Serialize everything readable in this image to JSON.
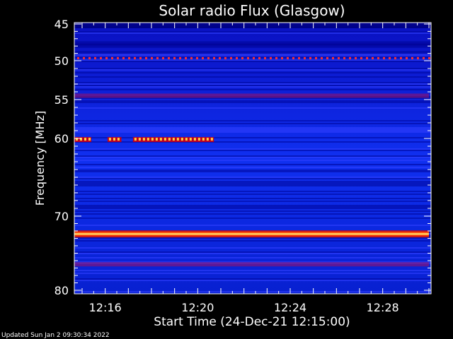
{
  "chart_data": {
    "type": "heatmap",
    "title": "Solar radio Flux (Glasgow)",
    "ylabel": "Frequency [MHz]",
    "xlabel": "Start Time (24-Dec-21 12:15:00)",
    "ylim": [
      80,
      45
    ],
    "yticks": [
      45,
      50,
      55,
      60,
      70,
      80
    ],
    "y_major_labels": [
      "45",
      "50",
      "55",
      "60",
      "70",
      "80"
    ],
    "x_range_minutes": [
      12.25,
      12.5
    ],
    "xticks": [
      "12:16",
      "12:20",
      "12:24",
      "12:28"
    ],
    "xtick_minutes_after_start": [
      1,
      5,
      9,
      13
    ],
    "x_span_minutes": [
      0,
      15
    ],
    "colormap": [
      "#0000a0",
      "#0020ff",
      "#a00040",
      "#ff2000",
      "#ffff60"
    ],
    "features": [
      {
        "label": "continuous band",
        "freq_mhz": 72.4,
        "start_min": 0,
        "end_min": 15,
        "intensity": "max"
      },
      {
        "label": "dotted line",
        "freq_mhz": 49.6,
        "start_min": 0,
        "end_min": 15,
        "intensity": "medium"
      },
      {
        "label": "intermittent band",
        "freq_mhz": 60.1,
        "start_min": 0,
        "end_min": 5.7,
        "intensity": "high"
      },
      {
        "label": "weak band",
        "freq_mhz": 54.5,
        "start_min": 0,
        "end_min": 15,
        "intensity": "low"
      },
      {
        "label": "weak band",
        "freq_mhz": 76.5,
        "start_min": 0,
        "end_min": 15,
        "intensity": "low"
      }
    ]
  },
  "footer": {
    "updated": "Updated Sun Jan  2 09:30:34 2022"
  }
}
